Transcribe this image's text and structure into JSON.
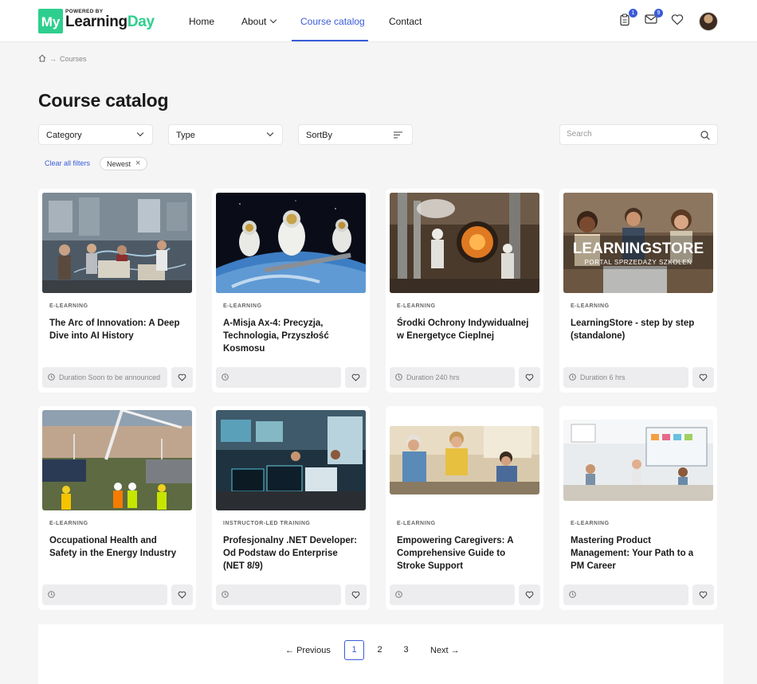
{
  "header": {
    "logo_prefix": "My",
    "logo_powered": "POWERED BY",
    "logo_name_a": "Learning",
    "logo_name_b": "Day",
    "nav": [
      "Home",
      "About",
      "Course catalog",
      "Contact"
    ],
    "active_nav": "Course catalog",
    "icons": [
      {
        "name": "clipboard-icon",
        "badge": "1"
      },
      {
        "name": "mail-icon",
        "badge": "9"
      },
      {
        "name": "heart-icon",
        "badge": ""
      }
    ]
  },
  "breadcrumb": {
    "home_icon": "home-icon",
    "separator": "→",
    "current": "Courses"
  },
  "page_title": "Course catalog",
  "filters": {
    "category": "Category",
    "type": "Type",
    "sort": "SortBy",
    "search_placeholder": "Search",
    "clear_all": "Clear all filters",
    "active_chip": "Newest"
  },
  "courses": [
    {
      "type": "E-LEARNING",
      "title": "The Arc of Innovation: A Deep Dive into AI History",
      "duration": "Duration Soon to be announced"
    },
    {
      "type": "E-LEARNING",
      "title": "A-Misja Ax-4: Precyzja, Technologia, Przyszłość Kosmosu",
      "duration": ""
    },
    {
      "type": "E-LEARNING",
      "title": "Środki Ochrony Indywidualnej w Energetyce Cieplnej",
      "duration": "Duration 240 hrs"
    },
    {
      "type": "E-LEARNING",
      "title": "LearningStore - step by step (standalone)",
      "duration": "Duration 6 hrs",
      "image_text": "LEARNINGSTORE",
      "image_subtext": "PORTAL SPRZEDAŻY SZKOLEŃ"
    },
    {
      "type": "E-LEARNING",
      "title": "Occupational Health and Safety in the Energy Industry",
      "duration": ""
    },
    {
      "type": "INSTRUCTOR-LED TRAINING",
      "title": "Profesjonalny .NET Developer: Od Podstaw do Enterprise (NET 8/9)",
      "duration": ""
    },
    {
      "type": "E-LEARNING",
      "title": "Empowering Caregivers: A Comprehensive Guide to Stroke Support",
      "duration": ""
    },
    {
      "type": "E-LEARNING",
      "title": "Mastering Product Management: Your Path to a PM Career",
      "duration": ""
    }
  ],
  "pagination": {
    "prev": "Previous",
    "next": "Next",
    "pages": [
      "1",
      "2",
      "3"
    ],
    "current": "1"
  },
  "colors": {
    "accent": "#3a5bd9",
    "brand": "#2ecf8e",
    "background": "#f5f5f6"
  }
}
